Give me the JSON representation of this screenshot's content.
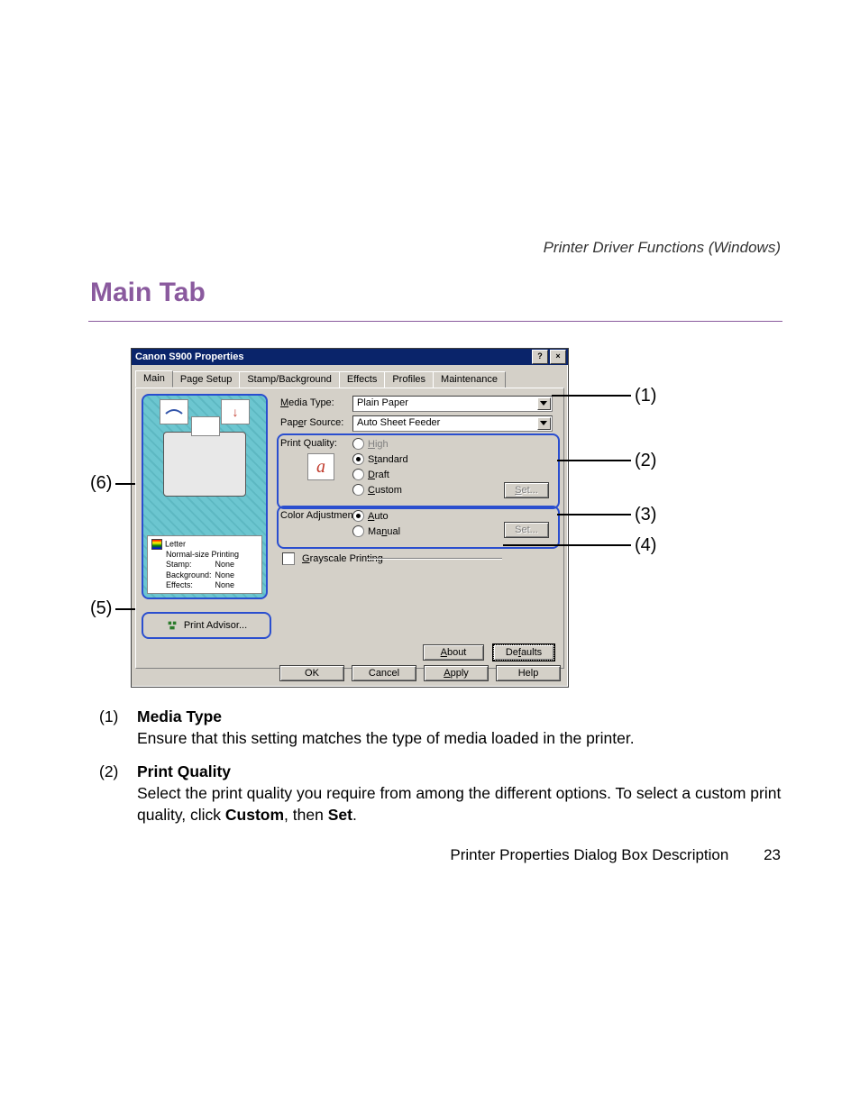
{
  "header_chapter": "Printer Driver Functions (Windows)",
  "main_heading": "Main Tab",
  "dialog": {
    "title": "Canon S900 Properties",
    "help_btn": "?",
    "close_btn": "×",
    "tabs": [
      "Main",
      "Page Setup",
      "Stamp/Background",
      "Effects",
      "Profiles",
      "Maintenance"
    ],
    "media_type_label": "Media Type:",
    "media_type_value": "Plain Paper",
    "paper_source_label": "Paper Source:",
    "paper_source_value": "Auto Sheet Feeder",
    "print_quality_label": "Print Quality:",
    "quality_options": {
      "high": "High",
      "standard": "Standard",
      "draft": "Draft",
      "custom": "Custom"
    },
    "color_adj_label": "Color Adjustment:",
    "color_adj_options": {
      "auto": "Auto",
      "manual": "Manual"
    },
    "set_btn": "Set...",
    "grayscale_label": "Grayscale Printing",
    "preview": {
      "paper": "Letter",
      "mode": "Normal-size Printing",
      "rows": [
        [
          "Stamp:",
          "None"
        ],
        [
          "Background:",
          "None"
        ],
        [
          "Effects:",
          "None"
        ]
      ]
    },
    "print_advisor": "Print Advisor...",
    "about_btn": "About",
    "defaults_btn": "Defaults",
    "ok_btn": "OK",
    "cancel_btn": "Cancel",
    "apply_btn": "Apply",
    "help_btn_bottom": "Help"
  },
  "callouts": {
    "c1": "(1)",
    "c2": "(2)",
    "c3": "(3)",
    "c4": "(4)",
    "c5": "(5)",
    "c6": "(6)"
  },
  "descriptions": [
    {
      "num": "(1)",
      "title": "Media Type",
      "body_plain": "Ensure that this setting matches the type of media loaded in the printer."
    },
    {
      "num": "(2)",
      "title": "Print Quality",
      "body_pre": "Select the print quality you require from among the different options. To select a custom print quality, click ",
      "bold1": "Custom",
      "mid": ", then ",
      "bold2": "Set",
      "post": "."
    }
  ],
  "footer": {
    "text": "Printer Properties Dialog Box Description",
    "page": "23"
  }
}
